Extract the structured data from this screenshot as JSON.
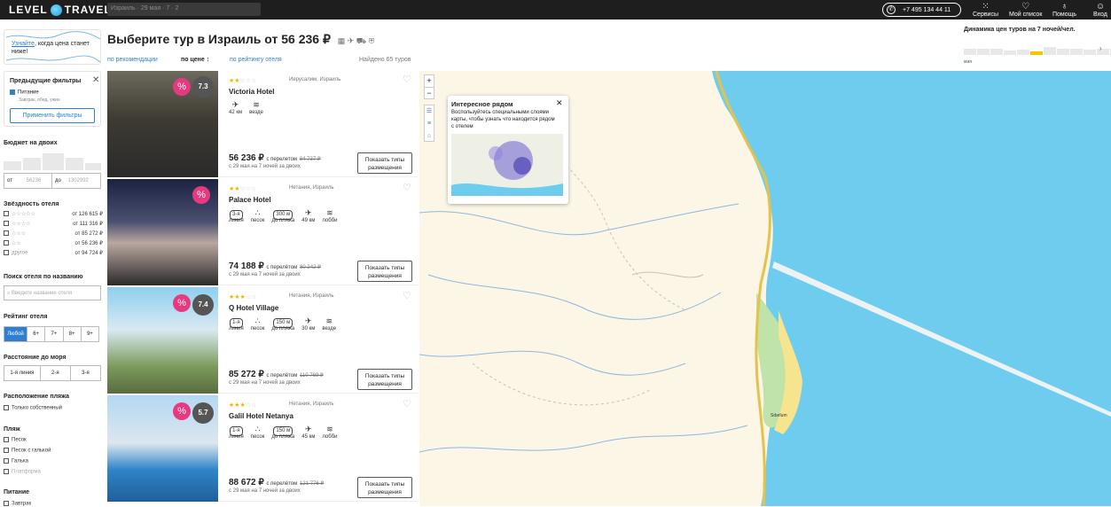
{
  "topbar": {
    "logo_left": "LEVEL",
    "logo_right": "TRAVEL",
    "search_value": "Израиль · 29 мая · 7 · 2",
    "phone": "+7 495 134 44 11",
    "nav": [
      {
        "label": "Сервисы",
        "icon": "grid-icon"
      },
      {
        "label": "Мой список",
        "icon": "heart-icon"
      },
      {
        "label": "Помощь",
        "icon": "help-icon"
      },
      {
        "label": "Вход",
        "icon": "user-icon"
      }
    ]
  },
  "subscribe": {
    "link": "Узнайте",
    "text": ", когда цена станет ниже!"
  },
  "prev_filters": {
    "title": "Предыдущие фильтры",
    "item": "Питание",
    "item_sub": "Завтрак, обед, ужин",
    "apply": "Применить фильтры"
  },
  "budget": {
    "title": "Бюджет на двоих",
    "from_label": "от",
    "from_value": "56236",
    "to_label": "до",
    "to_value": "1302992"
  },
  "stars_filter": {
    "title": "Звёздность отеля",
    "items": [
      {
        "stars": "☆☆☆☆☆",
        "price": "от 126 615 ₽"
      },
      {
        "stars": "☆☆☆☆",
        "price": "от 111 316 ₽"
      },
      {
        "stars": "☆☆☆",
        "price": "от 85 272 ₽"
      },
      {
        "stars": "☆☆",
        "price": "от 56 236 ₽"
      },
      {
        "stars": "другое",
        "price": "от 94 724 ₽"
      }
    ]
  },
  "hotel_search": {
    "title": "Поиск отеля по названию",
    "placeholder": "Введите название отеля"
  },
  "rating": {
    "title": "Рейтинг отеля",
    "options": [
      "Любой",
      "6+",
      "7+",
      "8+",
      "9+"
    ]
  },
  "sea": {
    "title": "Расстояние до моря",
    "options": [
      "1-я линия",
      "2-я",
      "3-я"
    ]
  },
  "beach_loc": {
    "title": "Расположение пляжа",
    "items": [
      "Только собственный"
    ]
  },
  "beach": {
    "title": "Пляж",
    "items": [
      "Песок",
      "Песок с галькой",
      "Галька",
      "Платформа"
    ]
  },
  "food": {
    "title": "Питание",
    "item": "Завтрак"
  },
  "header": {
    "title": "Выберите тур в Израиль от 56 236 ₽",
    "sorts": [
      "по рекомендации",
      "по цене ↕",
      "по рейтингу отеля"
    ],
    "found": "Найдено 65 туров"
  },
  "dynamics": {
    "title": "Динамика цен туров на 7 ночей/чел.",
    "label": "мая"
  },
  "hotels": [
    {
      "name": "Victoria Hotel",
      "location": "Иерусалим, Израиль",
      "stars": 2,
      "rating": "7.3",
      "amenities": [
        {
          "icon": "plane-icon",
          "label": "42 км"
        },
        {
          "icon": "wifi-icon",
          "label": "везде"
        }
      ],
      "price": "56 236 ₽",
      "with": "с перелетом",
      "old": "84 737 ₽",
      "dates": "с 29 мая на 7 ночей за двоих",
      "button": "Показать типы размещения"
    },
    {
      "name": "Palace Hotel",
      "location": "Нетания, Израиль",
      "stars": 2,
      "rating": "",
      "amenities": [
        {
          "icon": "line-icon",
          "label": "линия",
          "pill": "3-я"
        },
        {
          "icon": "sand-icon",
          "label": "песок"
        },
        {
          "icon": "distance-icon",
          "label": "до пляжа",
          "pill": "300 м"
        },
        {
          "icon": "plane-icon",
          "label": "49 км"
        },
        {
          "icon": "wifi-icon",
          "label": "лобби"
        }
      ],
      "price": "74 188 ₽",
      "with": "с перелётом",
      "old": "80 242 ₽",
      "dates": "с 29 мая на 7 ночей за двоих",
      "button": "Показать типы размещения"
    },
    {
      "name": "Q Hotel Village",
      "location": "Нетания, Израиль",
      "stars": 3,
      "rating": "7.4",
      "amenities": [
        {
          "icon": "line-icon",
          "label": "линия",
          "pill": "1-я"
        },
        {
          "icon": "sand-icon",
          "label": "песок"
        },
        {
          "icon": "distance-icon",
          "label": "до пляжа",
          "pill": "150 м"
        },
        {
          "icon": "plane-icon",
          "label": "30 км"
        },
        {
          "icon": "wifi-icon",
          "label": "везде"
        }
      ],
      "price": "85 272 ₽",
      "with": "с перелётом",
      "old": "110 769 ₽",
      "dates": "с 29 мая на 7 ночей за двоих",
      "button": "Показать типы размещения"
    },
    {
      "name": "Galil Hotel Netanya",
      "location": "Нетания, Израиль",
      "stars": 3,
      "rating": "5.7",
      "amenities": [
        {
          "icon": "line-icon",
          "label": "линия",
          "pill": "1-я"
        },
        {
          "icon": "sand-icon",
          "label": "песок"
        },
        {
          "icon": "distance-icon",
          "label": "до пляжа",
          "pill": "150 м"
        },
        {
          "icon": "plane-icon",
          "label": "45 км"
        },
        {
          "icon": "wifi-icon",
          "label": "лобби"
        }
      ],
      "price": "88 672 ₽",
      "with": "с перелётом",
      "old": "121 776 ₽",
      "dates": "с 29 мая на 7 ночей за двоих",
      "button": "Показать типы размещения"
    }
  ],
  "map": {
    "popup_title": "Интересное рядом",
    "popup_text": "Воспользуйтесь специальными слоями карты, чтобы узнать что находится рядом с отелем",
    "label": "Sdarlum",
    "zoom_in": "+",
    "zoom_out": "−"
  },
  "colors": {
    "accent": "#2f7fd1",
    "discount": "#e73a7e",
    "sea": "#6ecdee",
    "land": "#fbf6e6"
  }
}
